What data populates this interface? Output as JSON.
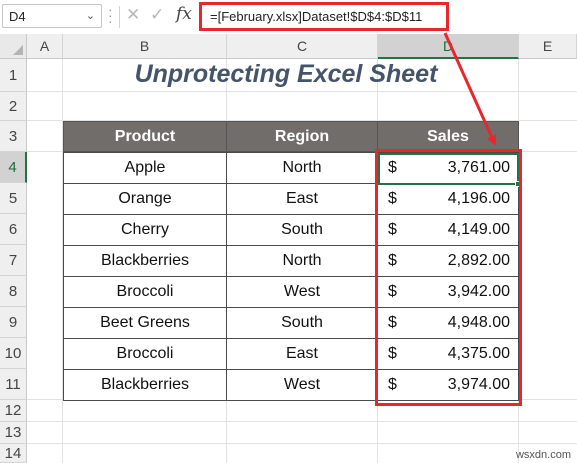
{
  "formula_bar": {
    "name_box": "D4",
    "formula": "=[February.xlsx]Dataset!$D$4:$D$11"
  },
  "grid": {
    "columns": [
      "A",
      "B",
      "C",
      "D",
      "E"
    ],
    "rows": [
      "1",
      "2",
      "3",
      "4",
      "5",
      "6",
      "7",
      "8",
      "9",
      "10",
      "11",
      "12",
      "13",
      "14"
    ],
    "active_column": "D",
    "active_row": "4"
  },
  "sheet": {
    "title": "Unprotecting Excel Sheet",
    "headers": [
      "Product",
      "Region",
      "Sales"
    ],
    "currency_symbol": "$",
    "rows": [
      {
        "product": "Apple",
        "region": "North",
        "sales": "3,761.00"
      },
      {
        "product": "Orange",
        "region": "East",
        "sales": "4,196.00"
      },
      {
        "product": "Cherry",
        "region": "South",
        "sales": "4,149.00"
      },
      {
        "product": "Blackberries",
        "region": "North",
        "sales": "2,892.00"
      },
      {
        "product": "Broccoli",
        "region": "West",
        "sales": "3,942.00"
      },
      {
        "product": "Beet Greens",
        "region": "South",
        "sales": "4,948.00"
      },
      {
        "product": "Broccoli",
        "region": "East",
        "sales": "4,375.00"
      },
      {
        "product": "Blackberries",
        "region": "West",
        "sales": "3,974.00"
      }
    ]
  },
  "icons": {
    "cancel": "cancel-icon",
    "enter": "enter-icon",
    "function": "fx-icon",
    "dropdown": "chevron-down-icon"
  },
  "colors": {
    "highlight": "#e8262d",
    "header_fill": "#716d6a",
    "title_color": "#44546a",
    "excel_green": "#217346"
  },
  "watermark": "wsxdn.com"
}
